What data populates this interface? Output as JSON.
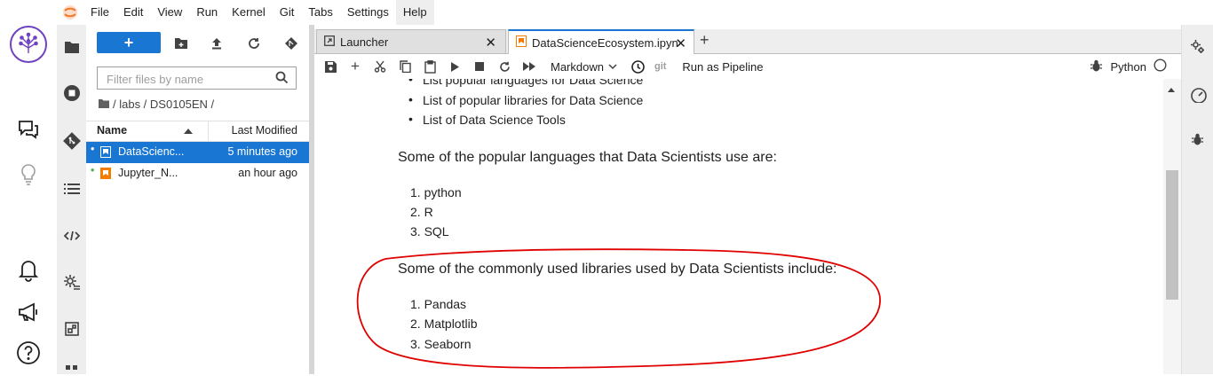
{
  "menu": [
    "File",
    "Edit",
    "View",
    "Run",
    "Kernel",
    "Git",
    "Tabs",
    "Settings",
    "Help"
  ],
  "filebrowser": {
    "filter_placeholder": "Filter files by name",
    "breadcrumb": "/ labs / DS0105EN /",
    "col_name": "Name",
    "col_modified": "Last Modified",
    "files": [
      {
        "name": "DataScienc...",
        "modified": "5 minutes ago",
        "selected": true
      },
      {
        "name": "Jupyter_N...",
        "modified": "an hour ago",
        "selected": false
      }
    ]
  },
  "tabs": [
    {
      "label": "Launcher"
    },
    {
      "label": "DataScienceEcosystem.ipyn"
    }
  ],
  "toolbar": {
    "cell_type": "Markdown",
    "git": "git",
    "pipeline": "Run as Pipeline",
    "kernel": "Python"
  },
  "notebook": {
    "partial_first": "List popular languages for Data Science",
    "bullets": [
      "List of popular libraries for Data Science",
      "List of Data Science Tools"
    ],
    "languages_intro": "Some of the popular languages that Data Scientists use are:",
    "languages": [
      "1. python",
      "2. R",
      "3. SQL"
    ],
    "libraries_intro": "Some of the commonly used libraries used by Data Scientists include:",
    "libraries": [
      "1. Pandas",
      "2. Matplotlib",
      "3. Seaborn"
    ]
  },
  "colors": {
    "accent": "#1976d2",
    "annotation": "#e00000",
    "notebook_tab": "#f57c00"
  }
}
